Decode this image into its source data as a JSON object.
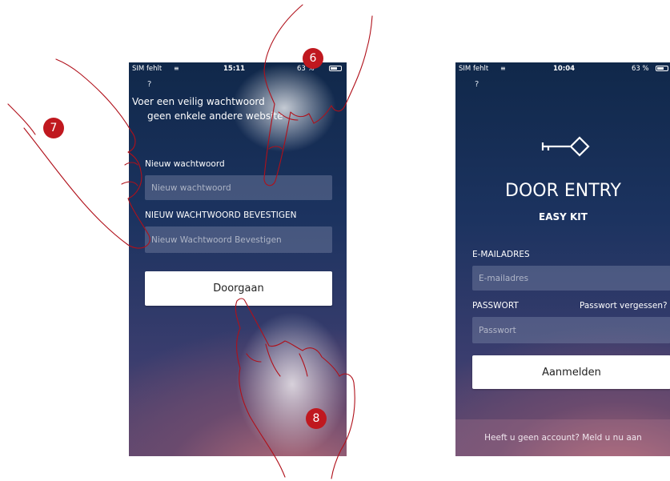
{
  "left_screen": {
    "status": {
      "carrier": "SIM fehlt",
      "time": "15:11",
      "battery": "63 %"
    },
    "help": "?",
    "intro_line1": "Voer een veilig wachtwoord",
    "intro_line2": "geen enkele andere website",
    "new_password_label": "Nieuw wachtwoord",
    "new_password_placeholder": "Nieuw wachtwoord",
    "confirm_label": "NIEUW WACHTWOORD BEVESTIGEN",
    "confirm_placeholder": "Nieuw Wachtwoord Bevestigen",
    "continue_button": "Doorgaan"
  },
  "right_screen": {
    "status": {
      "carrier": "SIM fehlt",
      "time": "10:04",
      "battery": "63 %"
    },
    "help": "?",
    "logo_icon": "key-icon",
    "title": "DOOR ENTRY",
    "subtitle": "EASY KIT",
    "email_label": "E-MAILADRES",
    "email_placeholder": "E-mailadres",
    "password_label": "PASSWORT",
    "forgot_link": "Passwort vergessen?",
    "password_placeholder": "Passwort",
    "login_button": "Aanmelden",
    "footer": "Heeft u geen account? Meld u nu aan"
  },
  "callouts": [
    "6",
    "7",
    "8"
  ],
  "colors": {
    "callout": "#c0181f",
    "hand_outline": "#b0101a"
  }
}
